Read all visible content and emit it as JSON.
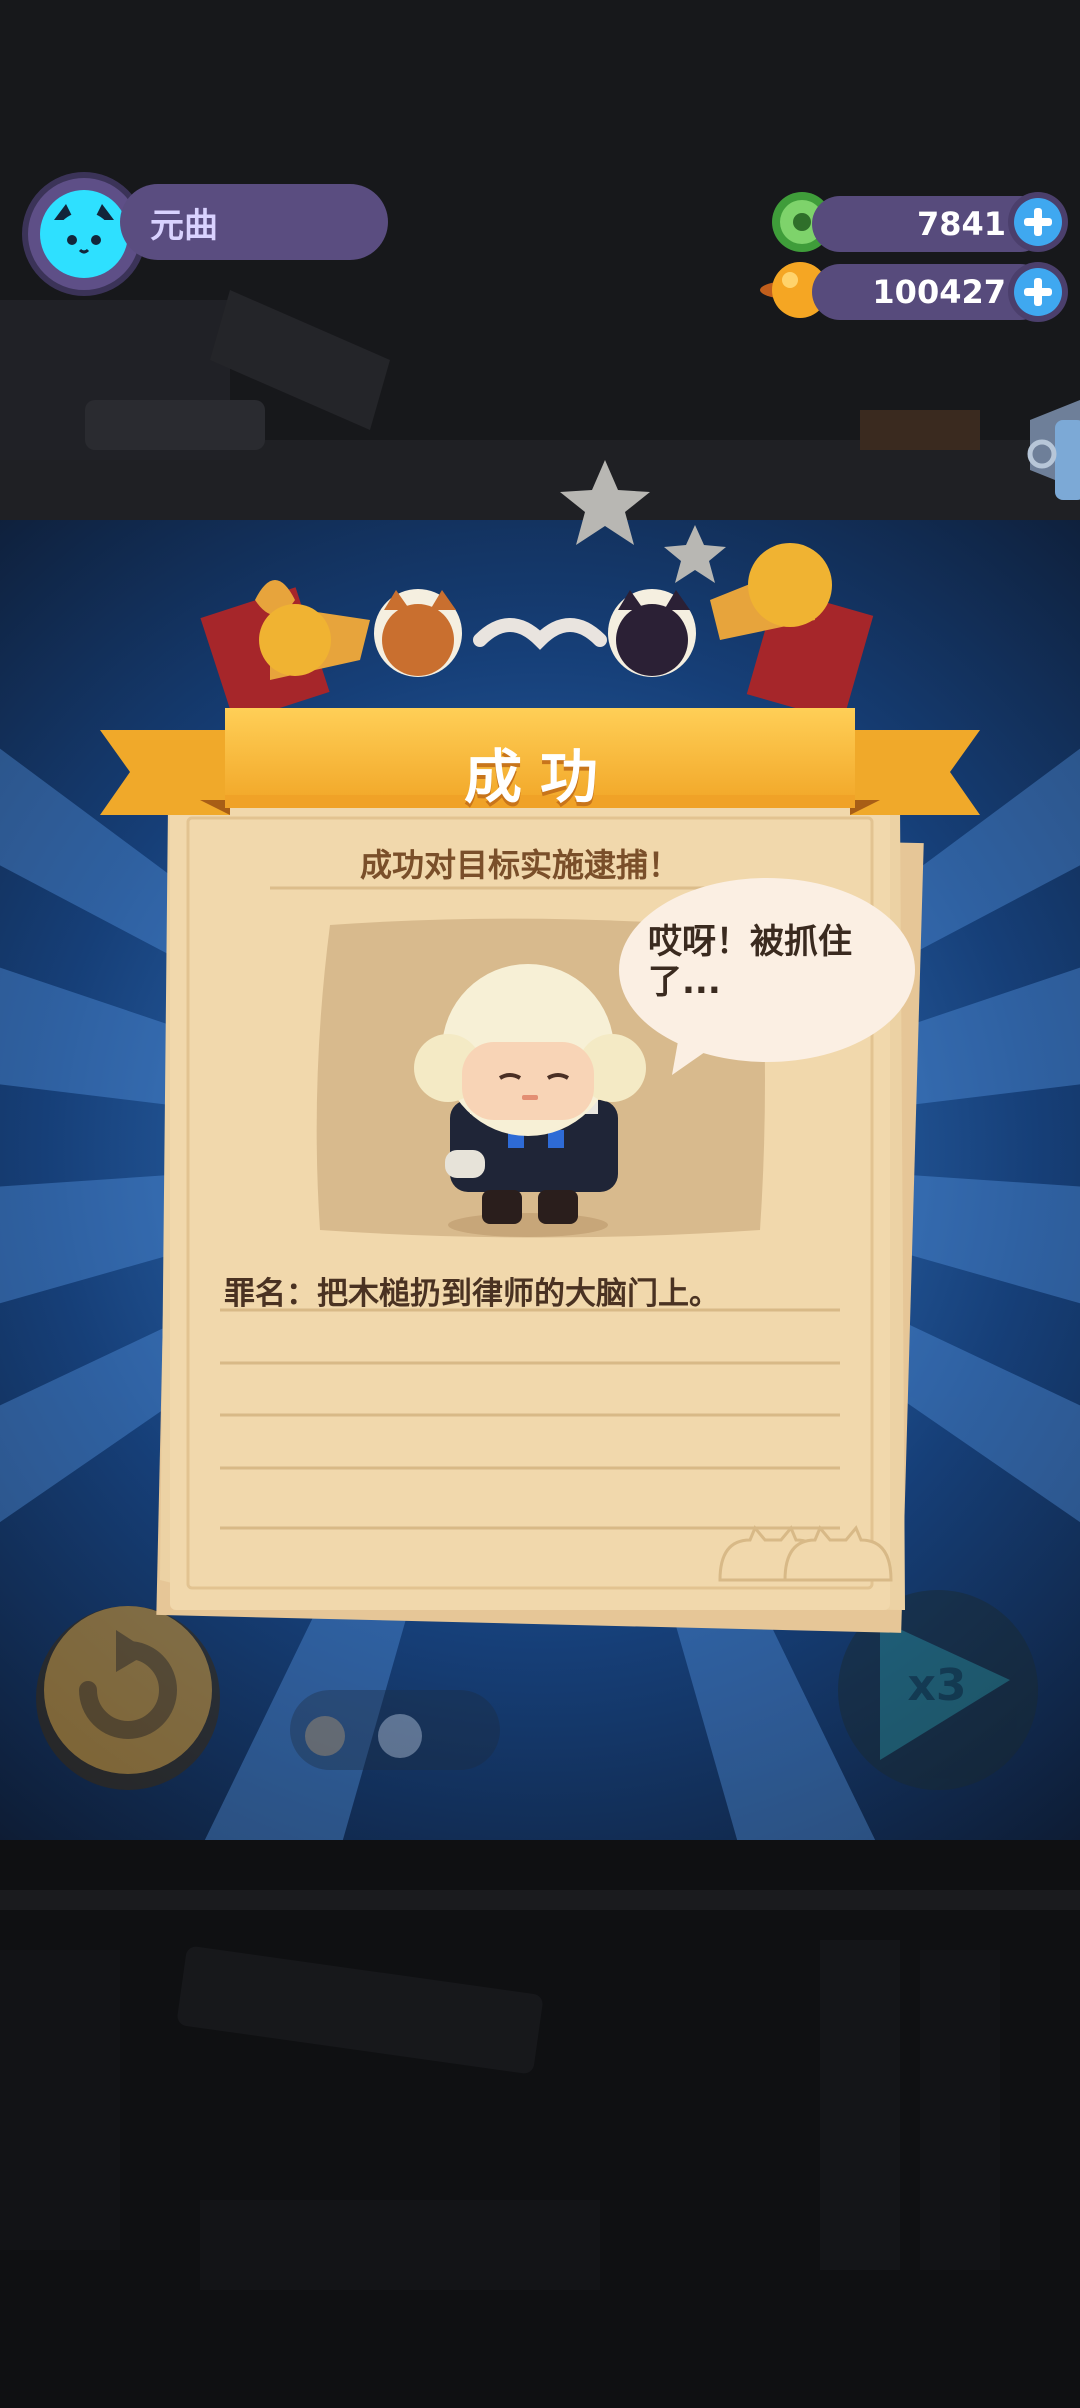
{
  "player": {
    "name": "元曲"
  },
  "currencies": [
    {
      "icon": "donut-icon",
      "value": "7841"
    },
    {
      "icon": "planet-coin-icon",
      "value": "100427"
    }
  ],
  "banner": {
    "title": "成功"
  },
  "result": {
    "subtitle": "成功对目标实施逮捕！",
    "speech": "哎呀！被抓住了...",
    "crime": "罪名：把木槌扔到律师的大脑门上。"
  },
  "buttons": {
    "speed_label": "x3"
  },
  "colors": {
    "ribbon": "#f5b83a",
    "paper": "#f1d8ac",
    "ray_blue": "#1f5aa8",
    "accent_plus": "#3fa8f0"
  }
}
